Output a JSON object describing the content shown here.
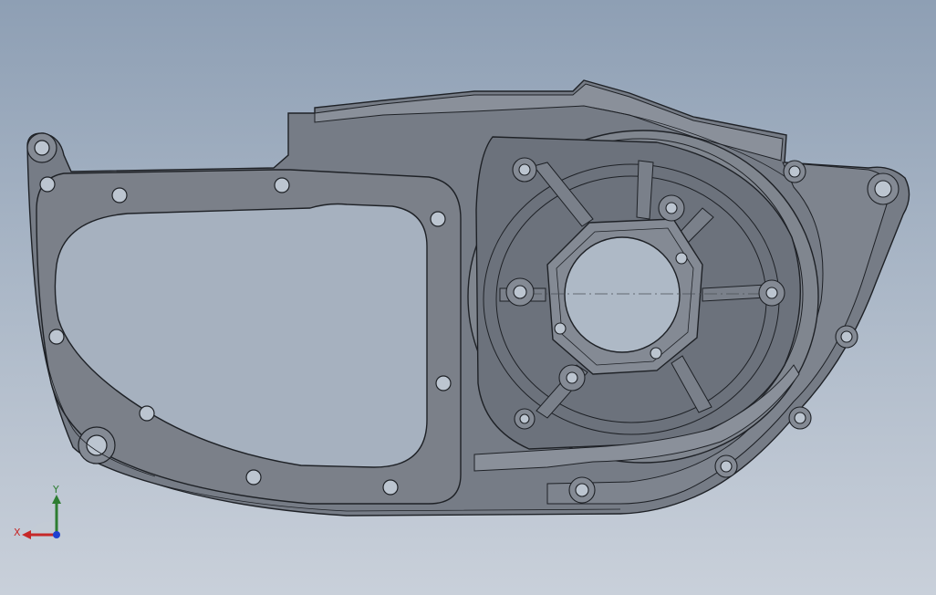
{
  "viewport": {
    "background_top": "#8e9fb4",
    "background_bottom": "#c9d0da",
    "part_color": "#767c86",
    "gasket_color": "#7b8089",
    "edge_color": "#1e2126"
  },
  "triad": {
    "x_label": "X",
    "y_label": "Y",
    "x_color": "#c62828",
    "y_color": "#2e7d32",
    "z_color": "#1e3fd0"
  }
}
